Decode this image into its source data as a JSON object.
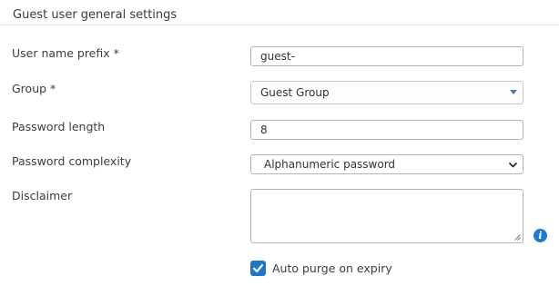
{
  "section": {
    "title": "Guest user general settings"
  },
  "fields": {
    "prefix": {
      "label": "User name prefix  *",
      "value": "guest-"
    },
    "group": {
      "label": "Group *",
      "value": "Guest Group"
    },
    "pwd_length": {
      "label": "Password length",
      "value": "8"
    },
    "complexity": {
      "label": "Password complexity",
      "value": "Alphanumeric password"
    },
    "disclaimer": {
      "label": "Disclaimer",
      "value": ""
    }
  },
  "auto_purge": {
    "label": "Auto purge on expiry",
    "checked": true
  },
  "icons": {
    "info": "info-icon",
    "dropdown": "chevron-down-icon",
    "check": "check-icon"
  },
  "colors": {
    "accent": "#1b76cf",
    "info": "#1f7ad1"
  }
}
